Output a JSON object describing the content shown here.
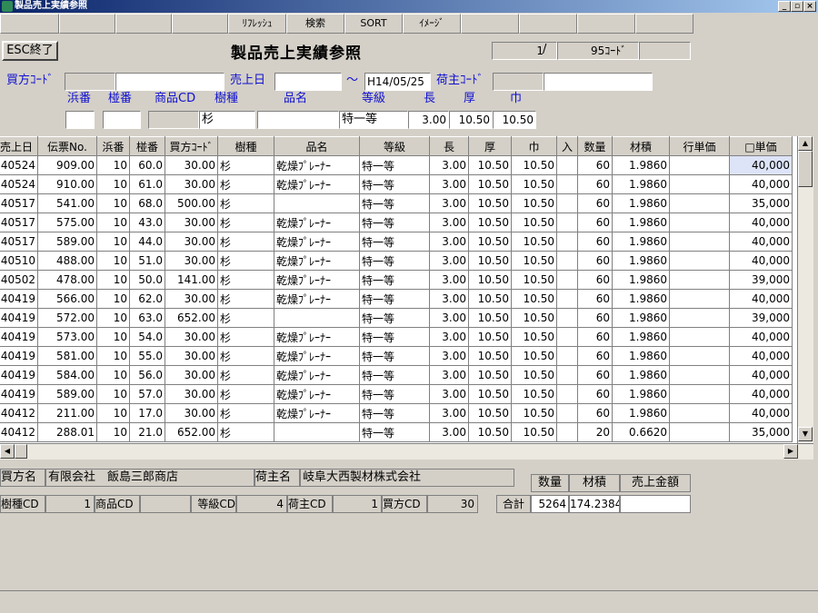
{
  "window": {
    "title": "製品売上実績参照"
  },
  "toolbar": {
    "refresh": "ﾘﾌﾚｯｼｭ",
    "search": "検索",
    "sort": "SORT",
    "image": "ｲﾒｰｼﾞ"
  },
  "header": {
    "esc_button": "ESC終了",
    "title": "製品売上実績参照",
    "record_current": "1",
    "record_total": "95",
    "record_unit": "ｺｰﾄﾞ"
  },
  "filters": {
    "buyer_code_label": "買方ｺｰﾄﾞ",
    "sale_date_label": "売上日",
    "tilde": "～",
    "date_to": "H14/05/25",
    "shipper_code_label": "荷主ｺｰﾄﾞ",
    "labels2": {
      "hama": "浜番",
      "hai": "椪番",
      "product_cd": "商品CD",
      "species": "樹種",
      "name": "品名",
      "grade": "等級",
      "length": "長",
      "thickness": "厚",
      "width": "巾"
    },
    "species_value": "杉",
    "grade_value": "特一等",
    "length_value": "3.00",
    "thickness_value": "10.50",
    "width_value": "10.50"
  },
  "grid": {
    "columns": [
      "売上日",
      "伝票No.",
      "浜番",
      "椪番",
      "買方ｺｰﾄﾞ",
      "樹種",
      "品名",
      "等級",
      "長",
      "厚",
      "巾",
      "入",
      "数量",
      "材積",
      "行単価",
      "□単価"
    ],
    "rows": [
      [
        "40524",
        "909.00",
        "10",
        "60.0",
        "30.00",
        "杉",
        "乾燥ﾌﾟﾚｰﾅｰ",
        "特一等",
        "3.00",
        "10.50",
        "10.50",
        "",
        "60",
        "1.9860",
        "",
        "40,000"
      ],
      [
        "40524",
        "910.00",
        "10",
        "61.0",
        "30.00",
        "杉",
        "乾燥ﾌﾟﾚｰﾅｰ",
        "特一等",
        "3.00",
        "10.50",
        "10.50",
        "",
        "60",
        "1.9860",
        "",
        "40,000"
      ],
      [
        "40517",
        "541.00",
        "10",
        "68.0",
        "500.00",
        "杉",
        "",
        "特一等",
        "3.00",
        "10.50",
        "10.50",
        "",
        "60",
        "1.9860",
        "",
        "35,000"
      ],
      [
        "40517",
        "575.00",
        "10",
        "43.0",
        "30.00",
        "杉",
        "乾燥ﾌﾟﾚｰﾅｰ",
        "特一等",
        "3.00",
        "10.50",
        "10.50",
        "",
        "60",
        "1.9860",
        "",
        "40,000"
      ],
      [
        "40517",
        "589.00",
        "10",
        "44.0",
        "30.00",
        "杉",
        "乾燥ﾌﾟﾚｰﾅｰ",
        "特一等",
        "3.00",
        "10.50",
        "10.50",
        "",
        "60",
        "1.9860",
        "",
        "40,000"
      ],
      [
        "40510",
        "488.00",
        "10",
        "51.0",
        "30.00",
        "杉",
        "乾燥ﾌﾟﾚｰﾅｰ",
        "特一等",
        "3.00",
        "10.50",
        "10.50",
        "",
        "60",
        "1.9860",
        "",
        "40,000"
      ],
      [
        "40502",
        "478.00",
        "10",
        "50.0",
        "141.00",
        "杉",
        "乾燥ﾌﾟﾚｰﾅｰ",
        "特一等",
        "3.00",
        "10.50",
        "10.50",
        "",
        "60",
        "1.9860",
        "",
        "39,000"
      ],
      [
        "40419",
        "566.00",
        "10",
        "62.0",
        "30.00",
        "杉",
        "乾燥ﾌﾟﾚｰﾅｰ",
        "特一等",
        "3.00",
        "10.50",
        "10.50",
        "",
        "60",
        "1.9860",
        "",
        "40,000"
      ],
      [
        "40419",
        "572.00",
        "10",
        "63.0",
        "652.00",
        "杉",
        "",
        "特一等",
        "3.00",
        "10.50",
        "10.50",
        "",
        "60",
        "1.9860",
        "",
        "39,000"
      ],
      [
        "40419",
        "573.00",
        "10",
        "54.0",
        "30.00",
        "杉",
        "乾燥ﾌﾟﾚｰﾅｰ",
        "特一等",
        "3.00",
        "10.50",
        "10.50",
        "",
        "60",
        "1.9860",
        "",
        "40,000"
      ],
      [
        "40419",
        "581.00",
        "10",
        "55.0",
        "30.00",
        "杉",
        "乾燥ﾌﾟﾚｰﾅｰ",
        "特一等",
        "3.00",
        "10.50",
        "10.50",
        "",
        "60",
        "1.9860",
        "",
        "40,000"
      ],
      [
        "40419",
        "584.00",
        "10",
        "56.0",
        "30.00",
        "杉",
        "乾燥ﾌﾟﾚｰﾅｰ",
        "特一等",
        "3.00",
        "10.50",
        "10.50",
        "",
        "60",
        "1.9860",
        "",
        "40,000"
      ],
      [
        "40419",
        "589.00",
        "10",
        "57.0",
        "30.00",
        "杉",
        "乾燥ﾌﾟﾚｰﾅｰ",
        "特一等",
        "3.00",
        "10.50",
        "10.50",
        "",
        "60",
        "1.9860",
        "",
        "40,000"
      ],
      [
        "40412",
        "211.00",
        "10",
        "17.0",
        "30.00",
        "杉",
        "乾燥ﾌﾟﾚｰﾅｰ",
        "特一等",
        "3.00",
        "10.50",
        "10.50",
        "",
        "60",
        "1.9860",
        "",
        "40,000"
      ],
      [
        "40412",
        "288.01",
        "10",
        "21.0",
        "652.00",
        "杉",
        "",
        "特一等",
        "3.00",
        "10.50",
        "10.50",
        "",
        "20",
        "0.6620",
        "",
        "35,000"
      ]
    ]
  },
  "footer": {
    "buyer_name_label": "買方名",
    "buyer_name": "有限会社　飯島三郎商店",
    "shipper_name_label": "荷主名",
    "shipper_name": "岐阜大西製材株式会社",
    "species_cd_label": "樹種CD",
    "species_cd": "1",
    "product_cd_label": "商品CD",
    "product_cd": "",
    "grade_cd_label": "等級CD",
    "grade_cd": "4",
    "shipper_cd_label": "荷主CD",
    "shipper_cd": "1",
    "buyer_cd_label": "買方CD",
    "buyer_cd": "30",
    "total_label": "合計",
    "qty_label": "数量",
    "volume_label": "材積",
    "sales_label": "売上金額",
    "qty_total": "5264",
    "volume_total": "174.2384",
    "sales_total": ""
  }
}
